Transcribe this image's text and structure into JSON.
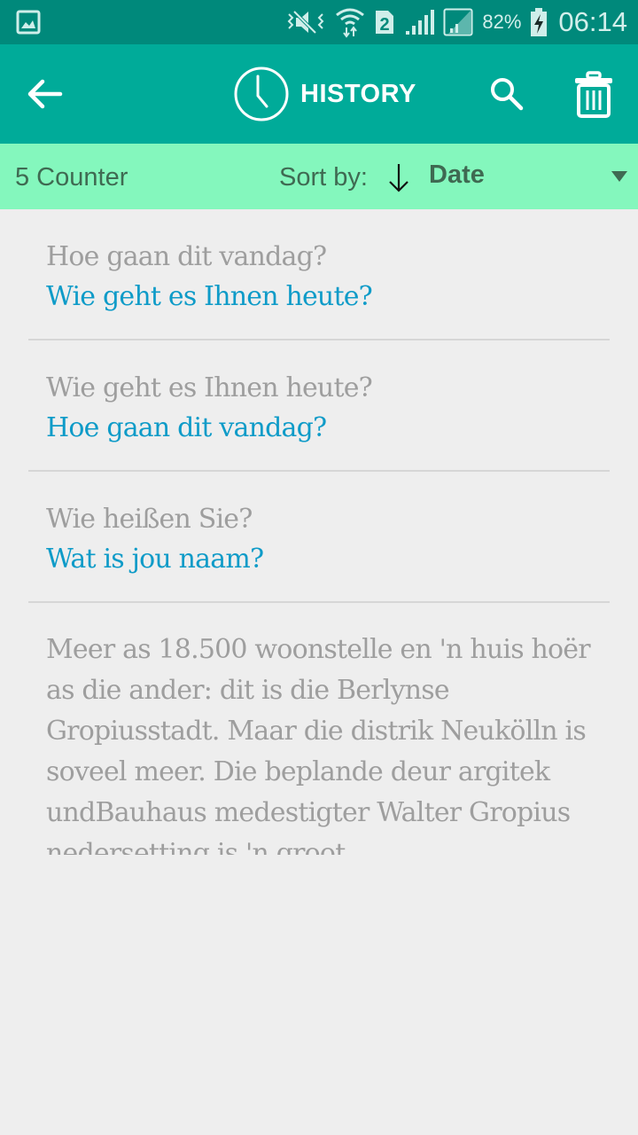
{
  "status_bar": {
    "battery_percent": "82%",
    "time": "06:14",
    "sim_slot": "2",
    "icons": [
      "gallery-icon",
      "vibrate-mute-icon",
      "wifi-icon",
      "sim2-icon",
      "signal-icon",
      "signal-roaming-icon",
      "battery-charging-icon"
    ]
  },
  "app_bar": {
    "title": "HISTORY",
    "back_icon": "arrow-left-icon",
    "title_icon": "clock-icon",
    "actions": [
      "search-icon",
      "trash-icon"
    ]
  },
  "sort_bar": {
    "counter": "5 Counter",
    "sort_label": "Sort by:",
    "sort_direction": "descending",
    "sort_value": "Date"
  },
  "history": [
    {
      "source": "Hoe gaan dit vandag?",
      "translation": "Wie geht es Ihnen heute?"
    },
    {
      "source": "Wie geht es Ihnen heute?",
      "translation": "Hoe gaan dit vandag?"
    },
    {
      "source": "Wie heißen Sie?",
      "translation": "Wat is jou naam?"
    },
    {
      "source": "Meer as 18.500 woonstelle en 'n huis hoër as die ander: dit is die Berlynse Gropiusstadt. Maar die distrik Neukölln is soveel meer. Die beplande deur argitek undBauhaus medestigter Walter Gropius nedersetting is 'n groot",
      "translation": ""
    }
  ],
  "colors": {
    "status_bar": "#00897b",
    "app_bar": "#00ab99",
    "sort_bar": "#84f7bd",
    "source_text": "#9e9e9e",
    "translation_text": "#0e9bc8",
    "background": "#eeeeee"
  }
}
